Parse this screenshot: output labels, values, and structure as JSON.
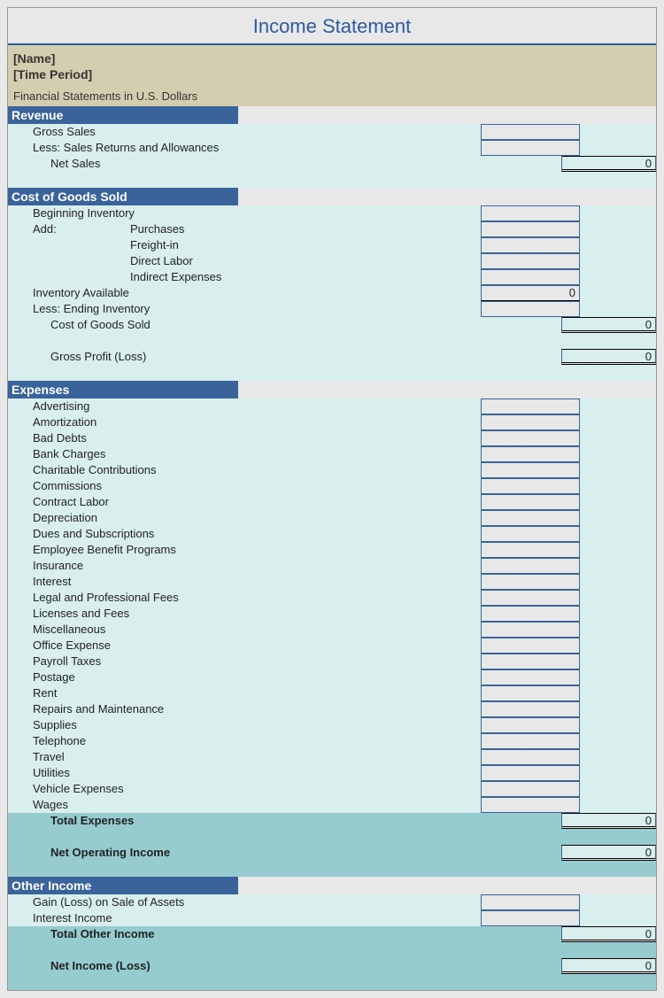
{
  "title": "Income Statement",
  "meta": {
    "name": "[Name]",
    "period": "[Time Period]",
    "note": "Financial Statements in U.S. Dollars"
  },
  "revenue": {
    "head": "Revenue",
    "rows": [
      {
        "label": "Gross Sales",
        "value": ""
      },
      {
        "label": "Less: Sales Returns and Allowances",
        "value": ""
      }
    ],
    "net": {
      "label": "Net Sales",
      "value": "0"
    }
  },
  "cogs": {
    "head": "Cost of Goods Sold",
    "beginning": {
      "label": "Beginning Inventory",
      "value": ""
    },
    "add_label": "Add:",
    "adds": [
      {
        "label": "Purchases",
        "value": ""
      },
      {
        "label": "Freight-in",
        "value": ""
      },
      {
        "label": "Direct Labor",
        "value": ""
      },
      {
        "label": "Indirect Expenses",
        "value": ""
      }
    ],
    "inv_avail": {
      "label": "Inventory Available",
      "value": "0"
    },
    "ending": {
      "label": "Less: Ending Inventory",
      "value": ""
    },
    "cogs_total": {
      "label": "Cost of Goods Sold",
      "value": "0"
    },
    "gross_profit": {
      "label": "Gross Profit (Loss)",
      "value": "0"
    }
  },
  "expenses": {
    "head": "Expenses",
    "rows": [
      "Advertising",
      "Amortization",
      "Bad Debts",
      "Bank Charges",
      "Charitable Contributions",
      "Commissions",
      "Contract Labor",
      "Depreciation",
      "Dues and Subscriptions",
      "Employee Benefit Programs",
      "Insurance",
      "Interest",
      "Legal and Professional Fees",
      "Licenses and Fees",
      "Miscellaneous",
      "Office Expense",
      "Payroll Taxes",
      "Postage",
      "Rent",
      "Repairs and Maintenance",
      "Supplies",
      "Telephone",
      "Travel",
      "Utilities",
      "Vehicle Expenses",
      "Wages"
    ],
    "total": {
      "label": "Total Expenses",
      "value": "0"
    },
    "net_op": {
      "label": "Net Operating Income",
      "value": "0"
    }
  },
  "other": {
    "head": "Other Income",
    "rows": [
      {
        "label": "Gain (Loss) on Sale of Assets",
        "value": ""
      },
      {
        "label": "Interest Income",
        "value": ""
      }
    ],
    "total": {
      "label": "Total Other Income",
      "value": "0"
    },
    "net_income": {
      "label": "Net Income (Loss)",
      "value": "0"
    }
  }
}
